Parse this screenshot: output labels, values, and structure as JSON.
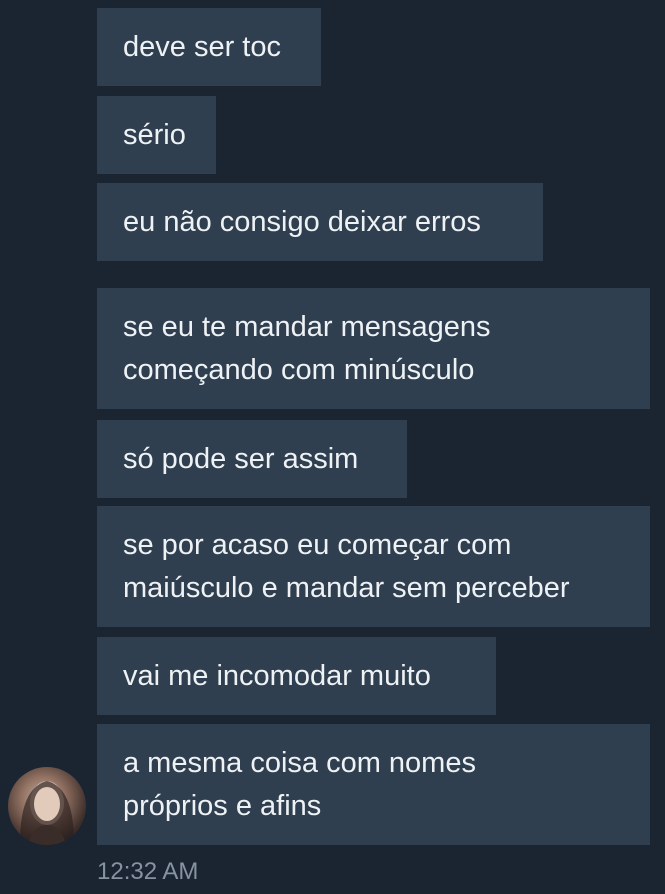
{
  "messages": [
    {
      "lines": [
        "deve ser toc"
      ]
    },
    {
      "lines": [
        "sério"
      ]
    },
    {
      "lines": [
        "eu não consigo deixar erros"
      ]
    },
    {
      "lines": [
        "se eu te mandar mensagens",
        "começando com minúsculo"
      ]
    },
    {
      "lines": [
        "só pode ser assim"
      ]
    },
    {
      "lines": [
        "se por acaso eu começar com",
        "maiúsculo e mandar sem perceber"
      ]
    },
    {
      "lines": [
        "vai me incomodar muito"
      ]
    },
    {
      "lines": [
        "a mesma coisa com nomes",
        "próprios e afins"
      ]
    }
  ],
  "timestamp": "12:32 AM",
  "colors": {
    "background": "#1b2532",
    "bubble": "#2f3f4f",
    "text": "#eef2f5",
    "timestamp": "#8693a0"
  }
}
